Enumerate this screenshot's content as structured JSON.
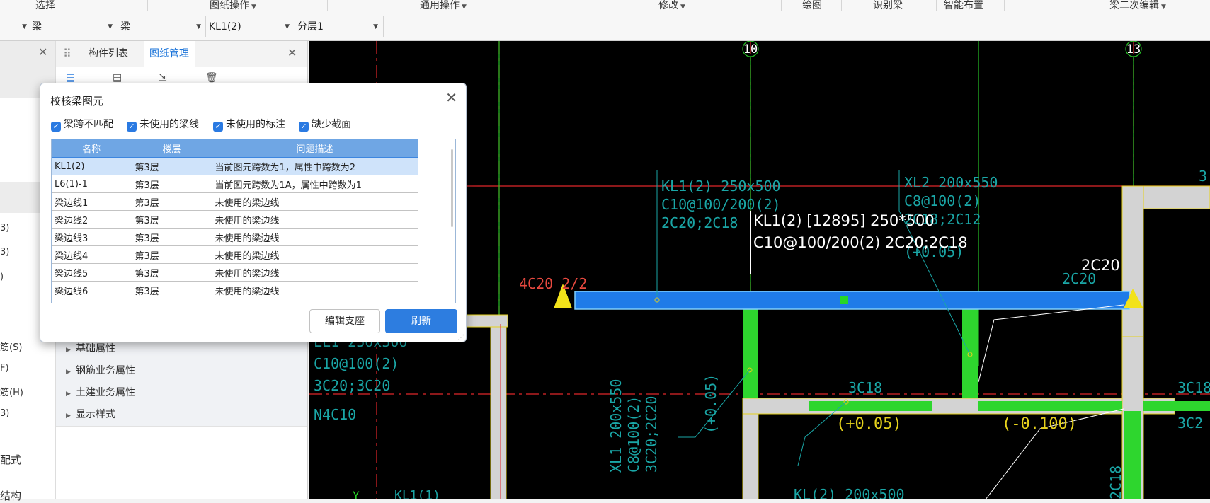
{
  "ribbon": {
    "groups": [
      "选择",
      "图纸操作",
      "通用操作",
      "修改",
      "绘图",
      "识别梁",
      "智能布置",
      "梁二次编辑"
    ]
  },
  "selector_bar": {
    "items": [
      "梁",
      "梁",
      "KL1(2)",
      "分层1"
    ]
  },
  "left_strip": {
    "items": [
      "3)",
      "3)",
      ")",
      "筋(S)",
      "F)",
      "筋(H)",
      "3)",
      "配式",
      "结构"
    ]
  },
  "panel": {
    "tabs": [
      "构件列表",
      "图纸管理"
    ],
    "properties": [
      "基础属性",
      "钢筋业务属性",
      "土建业务属性",
      "显示样式"
    ]
  },
  "dialog": {
    "title": "校核梁图元",
    "filters": [
      "梁跨不匹配",
      "未使用的梁线",
      "未使用的标注",
      "缺少截面"
    ],
    "columns": [
      "名称",
      "楼层",
      "问题描述"
    ],
    "rows": [
      {
        "name": "KL1(2)",
        "floor": "第3层",
        "desc": "当前图元跨数为1，属性中跨数为2"
      },
      {
        "name": "L6(1)-1",
        "floor": "第3层",
        "desc": "当前图元跨数为1A，属性中跨数为1"
      },
      {
        "name": "梁边线1",
        "floor": "第3层",
        "desc": "未使用的梁边线"
      },
      {
        "name": "梁边线2",
        "floor": "第3层",
        "desc": "未使用的梁边线"
      },
      {
        "name": "梁边线3",
        "floor": "第3层",
        "desc": "未使用的梁边线"
      },
      {
        "name": "梁边线4",
        "floor": "第3层",
        "desc": "未使用的梁边线"
      },
      {
        "name": "梁边线5",
        "floor": "第3层",
        "desc": "未使用的梁边线"
      },
      {
        "name": "梁边线6",
        "floor": "第3层",
        "desc": "未使用的梁边线"
      }
    ],
    "edit_button": "编辑支座",
    "refresh_button": "刷新"
  },
  "canvas": {
    "axis_labels": [
      "10",
      "13"
    ],
    "tooltip_line1": "KL1(2) [12895] 250*500",
    "tooltip_line2": "C10@100/200(2) 2C20;2C18",
    "texts": {
      "kl1_a": "KL1(2) 250x500",
      "kl1_b": "C10@100/200(2)",
      "kl1_c": "2C20;2C18",
      "xl2_a": "XL2 200x550",
      "xl2_b": "C8@100(2)",
      "xl2_c": "2C18;2C12",
      "xl2_d": "(+0.05)",
      "top_left_bar": "4C20 2/2",
      "bar_2c20_white": "2C20",
      "bar_2c20_cyan": "2C20",
      "ll1_a": "LL1 250x500",
      "ll1_b": "C10@100(2)",
      "ll1_c": "3C20;3C20",
      "ll1_d": "N4C10",
      "xl1_a": "XL1 200x550",
      "xl1_b": "C8@100(2)",
      "xl1_c": "3C20;2C20",
      "xl1_d": "(+0.05)",
      "c3c18": "3C18",
      "elev1": "(+0.05)",
      "elev2": "(-0.100)",
      "right_3c": "3C18",
      "right_3c2": "3C2",
      "right_top_3": "3",
      "bottom_y": "Y",
      "bottom_kl": "KL1(1)",
      "bottom_mid": "KL(2) 200x500",
      "vert_2c18": "2C18"
    }
  },
  "colors": {
    "accent": "#2d7de0",
    "beam_selected": "#1f7be8",
    "beam_green": "#2ed62e",
    "axis_red": "#e0262a",
    "cad_cyan": "#1aa6a6",
    "cad_yellow": "#e6d21c"
  }
}
